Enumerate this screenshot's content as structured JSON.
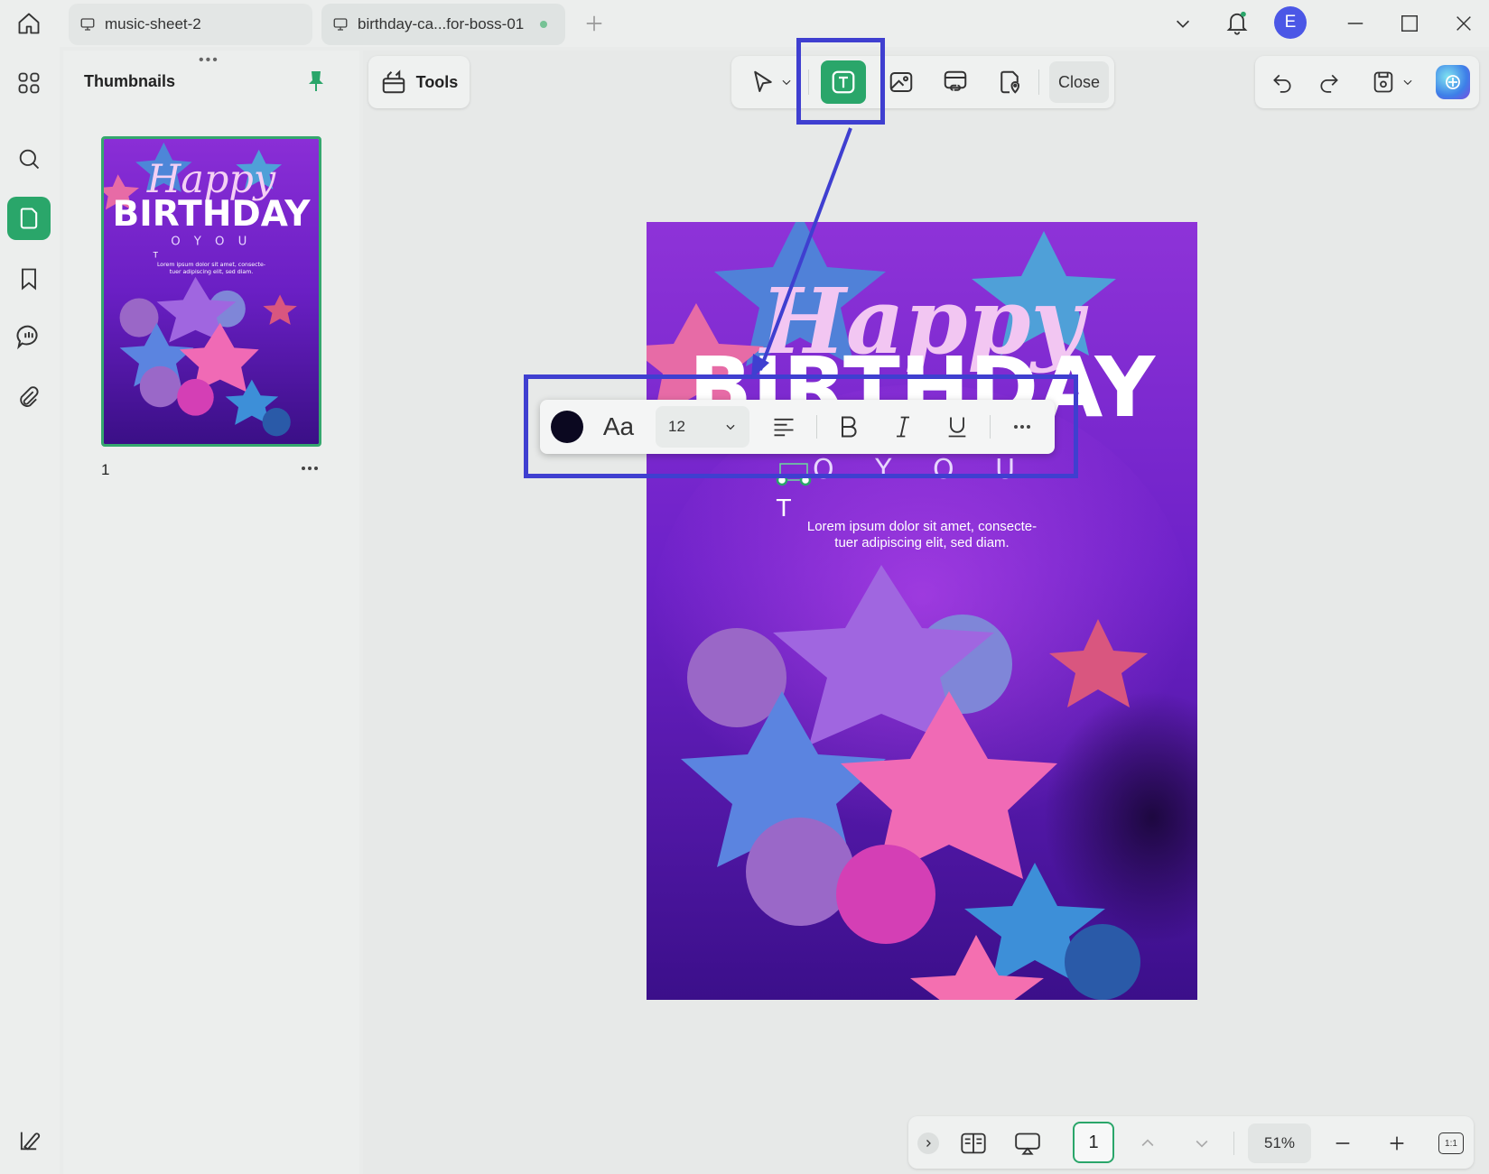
{
  "tabs": [
    {
      "title": "music-sheet-2"
    },
    {
      "title": "birthday-ca...for-boss-01"
    }
  ],
  "user": {
    "avatar_letter": "E"
  },
  "panel": {
    "title": "Thumbnails",
    "page_number": "1"
  },
  "toolbar": {
    "tools_label": "Tools",
    "close_label": "Close"
  },
  "format": {
    "font_size": "12",
    "font_icon_label": "Aa"
  },
  "card": {
    "headline_script": "Happy",
    "headline_block": "BIRTHDAY",
    "subline": "O  Y O U",
    "body_text_line1": "Lorem ipsum dolor sit amet, consecte-",
    "body_text_line2": "tuer adipiscing elit, sed diam.",
    "text_cursor": "T"
  },
  "thumb": {
    "headline_script": "Happy",
    "headline_block": "BIRTHDAY",
    "subline": "O  Y O U",
    "body_text_line1": "Lorem ipsum dolor sit amet, consecte-",
    "body_text_line2": "tuer adipiscing elit, sed diam.",
    "text_cursor": "T"
  },
  "bottom": {
    "page_input": "1",
    "zoom": "51%",
    "fit_label": "1:1"
  },
  "colors": {
    "accent": "#2aa66a",
    "highlight": "#3f3fd0",
    "avatar": "#4b57e6",
    "text_color_swatch": "#0b0820"
  }
}
